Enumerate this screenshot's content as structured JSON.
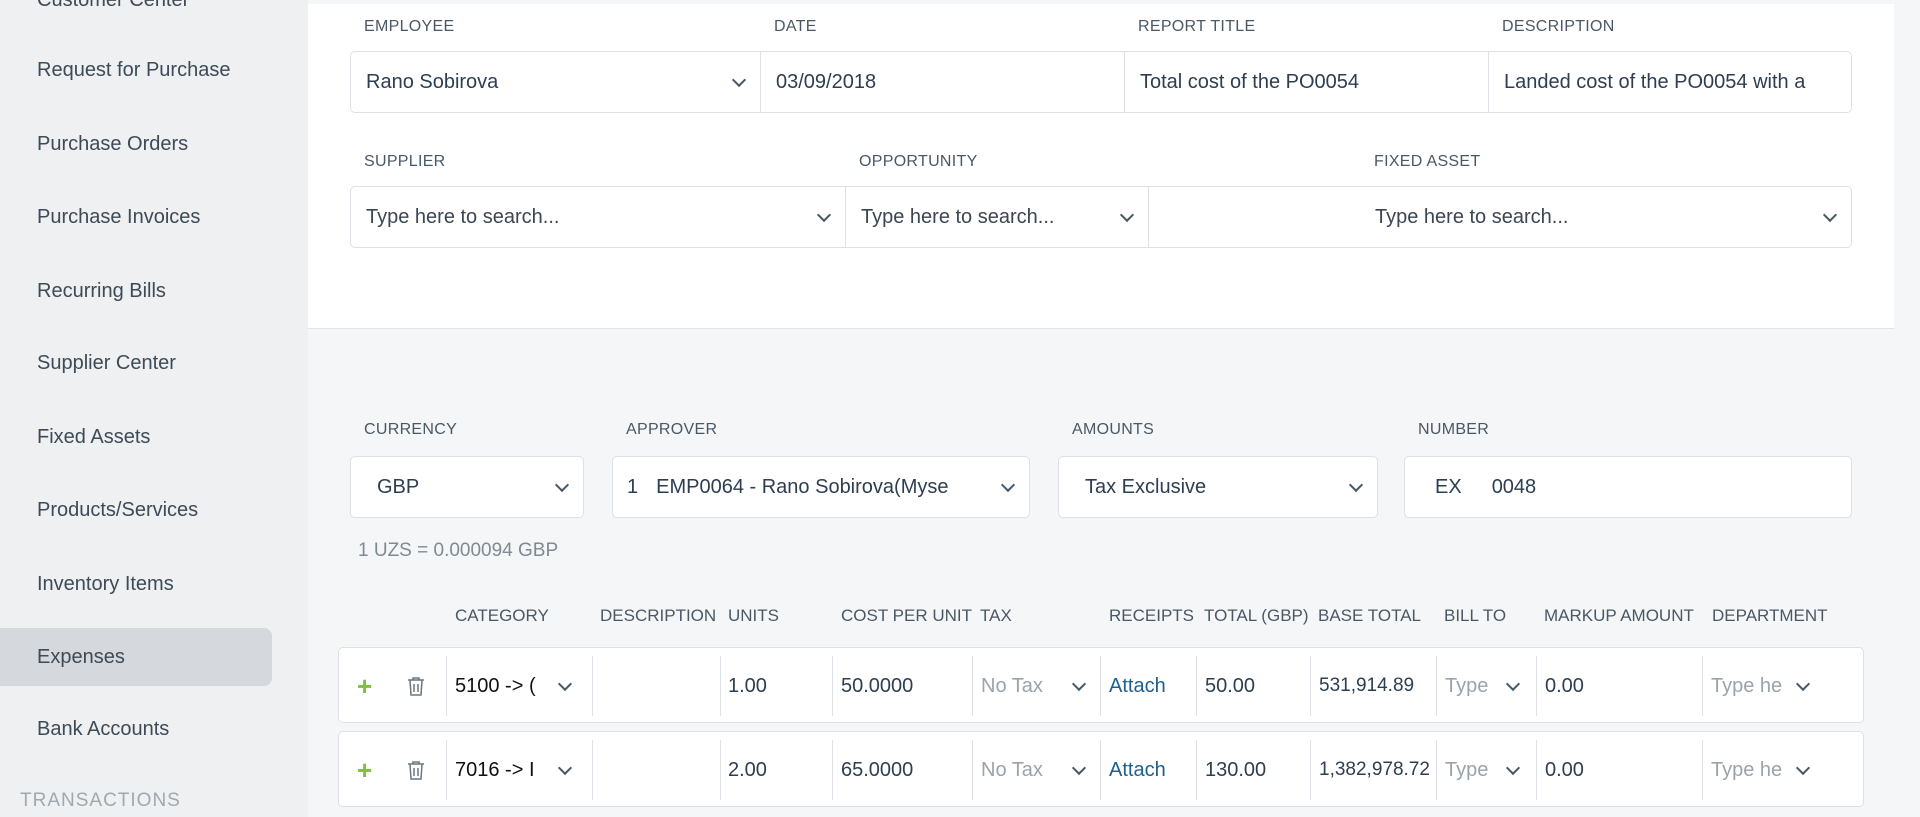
{
  "sidebar": {
    "items": [
      {
        "label": "Customer Center"
      },
      {
        "label": "Request for Purchase"
      },
      {
        "label": "Purchase Orders"
      },
      {
        "label": "Purchase Invoices"
      },
      {
        "label": "Recurring Bills"
      },
      {
        "label": "Supplier Center"
      },
      {
        "label": "Fixed Assets"
      },
      {
        "label": "Products/Services"
      },
      {
        "label": "Inventory Items"
      },
      {
        "label": "Expenses"
      },
      {
        "label": "Bank Accounts"
      }
    ],
    "active": "Expenses",
    "section": "TRANSACTIONS"
  },
  "form": {
    "employee_label": "EMPLOYEE",
    "employee_value": "Rano Sobirova",
    "date_label": "DATE",
    "date_value": "03/09/2018",
    "report_title_label": "REPORT TITLE",
    "report_title_value": "Total cost of the PO0054",
    "description_label": "DESCRIPTION",
    "description_value": "Landed cost of the PO0054 with a",
    "supplier_label": "SUPPLIER",
    "supplier_placeholder": "Type here to search...",
    "opportunity_label": "OPPORTUNITY",
    "opportunity_placeholder": "Type here to search...",
    "fixed_asset_label": "FIXED ASSET",
    "fixed_asset_placeholder": "Type here to search..."
  },
  "settings": {
    "currency_label": "CURRENCY",
    "currency_value": "GBP",
    "approver_label": "APPROVER",
    "approver_index": "1",
    "approver_value": "EMP0064 - Rano Sobirova(Myse",
    "amounts_label": "AMOUNTS",
    "amounts_value": "Tax Exclusive",
    "number_label": "NUMBER",
    "number_prefix": "EX",
    "number_value": "0048",
    "rate_text": "1 UZS = 0.000094 GBP"
  },
  "table": {
    "headers": {
      "category": "CATEGORY",
      "description": "DESCRIPTION",
      "units": "UNITS",
      "cost_per_unit": "COST PER UNIT",
      "tax": "TAX",
      "receipts": "RECEIPTS",
      "total": "TOTAL (GBP)",
      "base_total": "BASE TOTAL",
      "bill_to": "BILL TO",
      "markup": "MARKUP AMOUNT",
      "department": "DEPARTMENT"
    },
    "rows": [
      {
        "plus": "+",
        "category": "5100 -> (",
        "description": "",
        "units": "1.00",
        "cost": "50.0000",
        "tax": "No Tax",
        "receipts": "Attach",
        "total": "50.00",
        "base_total": "531,914.89",
        "bill_to": "Type",
        "markup": "0.00",
        "department": "Type he"
      },
      {
        "plus": "+",
        "category": "7016 -> I",
        "description": "",
        "units": "2.00",
        "cost": "65.0000",
        "tax": "No Tax",
        "receipts": "Attach",
        "total": "130.00",
        "base_total": "1,382,978.72",
        "bill_to": "Type",
        "markup": "0.00",
        "department": "Type he"
      }
    ]
  },
  "colors": {
    "accent_green": "#7fbf3f",
    "link_blue": "#1f5f8b",
    "sidebar_active": "#d5d9de"
  }
}
